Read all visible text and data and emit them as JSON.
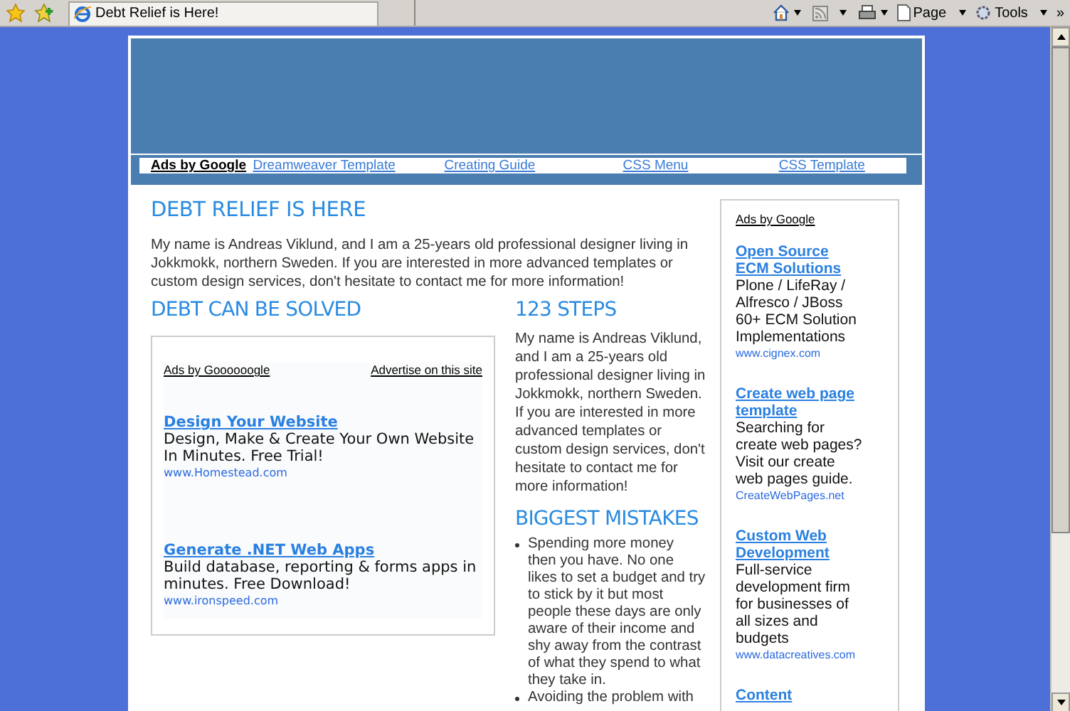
{
  "browser": {
    "tab_title": "Debt Relief is Here!",
    "menus": [
      "Page",
      "Tools"
    ],
    "more": "»"
  },
  "nav": {
    "ads_label": "Ads by Google",
    "links": [
      "Dreamweaver Template",
      "Creating Guide",
      "CSS Menu",
      "CSS Template"
    ]
  },
  "intro": {
    "heading": "DEBT RELIEF IS HERE",
    "text": "My name is Andreas Viklund, and I am a 25-years old professional designer living in Jokkmokk, northern Sweden. If you are interested in more advanced templates or custom design services, don't hesitate to contact me for more information!"
  },
  "left": {
    "heading": "DEBT CAN BE SOLVED",
    "ads": {
      "label": "Ads by Goooooogle",
      "advertise": "Advertise on this site",
      "items": [
        {
          "title": "Design Your Website",
          "text": "Design, Make & Create Your Own Website In Minutes. Free Trial!",
          "url": "www.Homestead.com"
        },
        {
          "title": "Generate .NET Web Apps",
          "text": "Build database, reporting & forms apps in minutes. Free Download!",
          "url": "www.ironspeed.com"
        }
      ]
    }
  },
  "middle": [
    {
      "heading": "123 STEPS",
      "text": "My name is Andreas Viklund, and I am a 25-years old professional designer living in Jokkmokk, northern Sweden. If you are interested in more advanced templates or custom design services, don't hesitate to contact me for more information!"
    },
    {
      "heading": "BIGGEST MISTAKES",
      "bullets": [
        "Spending more money then you have. No one likes to set a budget and try to stick by it but most people these days are only aware of their income and shy away from the contrast of what they spend to what they take in.",
        "Avoiding the problem with"
      ]
    }
  ],
  "sidebar": {
    "label": "Ads by Google",
    "items": [
      {
        "title": "Open Source ECM Solutions",
        "text": "Plone / LifeRay / Alfresco / JBoss 60+ ECM Solution Implementations",
        "url": "www.cignex.com"
      },
      {
        "title": "Create web page template",
        "text": "Searching for create web pages? Visit our create web pages guide.",
        "url": "CreateWebPages.net"
      },
      {
        "title": "Custom Web Development",
        "text": "Full-service development firm for businesses of all sizes and budgets",
        "url": "www.datacreatives.com"
      },
      {
        "title": "Content"
      }
    ]
  }
}
